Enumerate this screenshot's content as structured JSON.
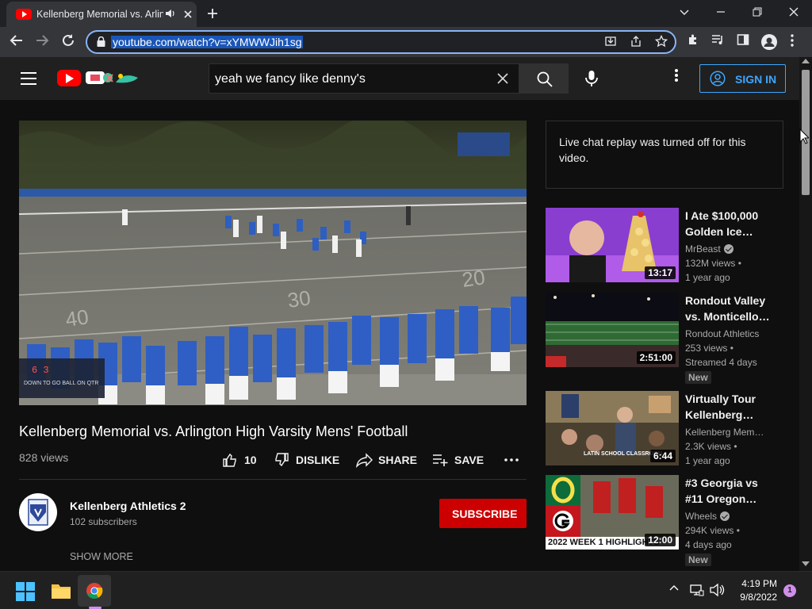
{
  "browser": {
    "tab_title": "Kellenberg Memorial vs. Arlington High Varsity Mens' Football - YouTube",
    "url": "youtube.com/watch?v=xYMWWJih1sg",
    "icons": [
      "audio-icon",
      "close-icon",
      "new-tab-icon",
      "minimize-icon",
      "maximize-icon",
      "window-close-icon",
      "back-icon",
      "forward-icon",
      "reload-icon",
      "lock-icon",
      "install-icon",
      "share-icon",
      "bookmark-star-icon",
      "extensions-icon",
      "media-icon",
      "sidepanel-icon",
      "profile-icon",
      "menu-icon"
    ]
  },
  "youtube": {
    "search_query": "yeah we fancy like denny's",
    "signin_label": "SIGN IN"
  },
  "video": {
    "title": "Kellenberg Memorial vs. Arlington High Varsity Mens' Football",
    "views": "828 views",
    "likes": "10",
    "dislike_label": "DISLIKE",
    "share_label": "SHARE",
    "save_label": "SAVE",
    "overlay": {
      "scoreboard_left": "6 3",
      "scoreboard_row": "DOWN TO GO BALL ON QTR"
    }
  },
  "channel": {
    "name": "Kellenberg Athletics 2",
    "subscribers": "102 subscribers",
    "subscribe_label": "SUBSCRIBE",
    "show_more": "SHOW MORE"
  },
  "sidebar": {
    "livechat_notice": "Live chat replay was turned off for this video.",
    "recommendations": [
      {
        "title": "I Ate $100,000 Golden Ice…",
        "channel": "MrBeast",
        "verified": true,
        "views": "132M views",
        "age": "1 year ago",
        "duration": "13:17",
        "badge": ""
      },
      {
        "title": "Rondout Valley vs. Monticello…",
        "channel": "Rondout Athletics",
        "verified": false,
        "views": "253 views",
        "age": "Streamed 4 days",
        "duration": "2:51:00",
        "badge": "New"
      },
      {
        "title": "Virtually Tour Kellenberg…",
        "channel": "Kellenberg Mem…",
        "verified": false,
        "views": "2.3K views",
        "age": "1 year ago",
        "duration": "6:44",
        "badge": ""
      },
      {
        "title": "#3 Georgia vs #11 Oregon…",
        "channel": "Wheels",
        "verified": true,
        "views": "294K views",
        "age": "4 days ago",
        "duration": "12:00",
        "badge": "New"
      }
    ],
    "thumb_text": {
      "classroom": "LATIN SCHOOL CLASSROOM",
      "georgia_caption": "2022 WEEK 1 HIGHLIGHTS"
    }
  },
  "taskbar": {
    "time": "4:19 PM",
    "date": "9/8/2022",
    "notification_count": "1"
  },
  "colors": {
    "accent_blue": "#3ea6ff",
    "subscribe_red": "#cc0000",
    "youtube_red": "#ff0000",
    "background": "#0f0f0f"
  }
}
